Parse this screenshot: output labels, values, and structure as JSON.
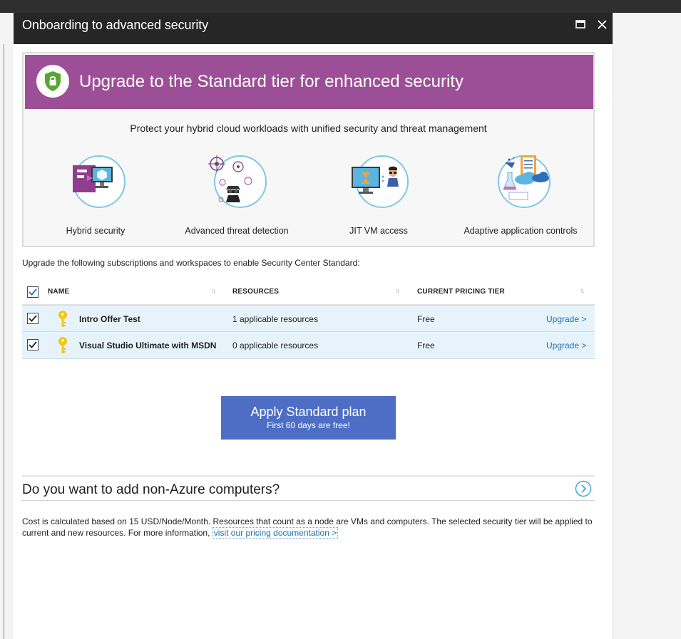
{
  "blade": {
    "title": "Onboarding to advanced security"
  },
  "banner": {
    "title": "Upgrade to the Standard tier for enhanced security",
    "subtitle": "Protect your hybrid cloud workloads with unified security and threat management",
    "color": "#9c4f96"
  },
  "features": [
    {
      "label": "Hybrid security",
      "icon": "hybrid-security-icon"
    },
    {
      "label": "Advanced threat detection",
      "icon": "threat-detection-icon"
    },
    {
      "label": "JIT VM access",
      "icon": "jit-vm-access-icon"
    },
    {
      "label": "Adaptive application controls",
      "icon": "adaptive-app-controls-icon"
    }
  ],
  "subscriptions": {
    "intro": "Upgrade the following subscriptions and workspaces to enable Security Center Standard:",
    "columns": {
      "name": "NAME",
      "resources": "RESOURCES",
      "tier": "CURRENT PRICING TIER"
    },
    "sort_glyph": "↑↓",
    "rows": [
      {
        "name": "Intro Offer Test",
        "resources": "1 applicable resources",
        "tier": "Free",
        "action": "Upgrade >",
        "checked": true
      },
      {
        "name": "Visual Studio Ultimate with MSDN",
        "resources": "0 applicable resources",
        "tier": "Free",
        "action": "Upgrade >",
        "checked": true
      }
    ]
  },
  "apply_button": {
    "label": "Apply Standard plan",
    "sublabel": "First 60 days are free!",
    "color": "#4e6ec6"
  },
  "non_azure": {
    "title": "Do you want to add non-Azure computers?"
  },
  "footnote": {
    "text": "Cost is calculated based on 15 USD/Node/Month. Resources that count as a node are VMs and computers. The selected security tier will be applied to current and new resources. For more information, ",
    "link": "visit our pricing documentation >"
  },
  "colors": {
    "header": "#262626",
    "link": "#1571b8",
    "row_selected": "#e6f3fb"
  }
}
